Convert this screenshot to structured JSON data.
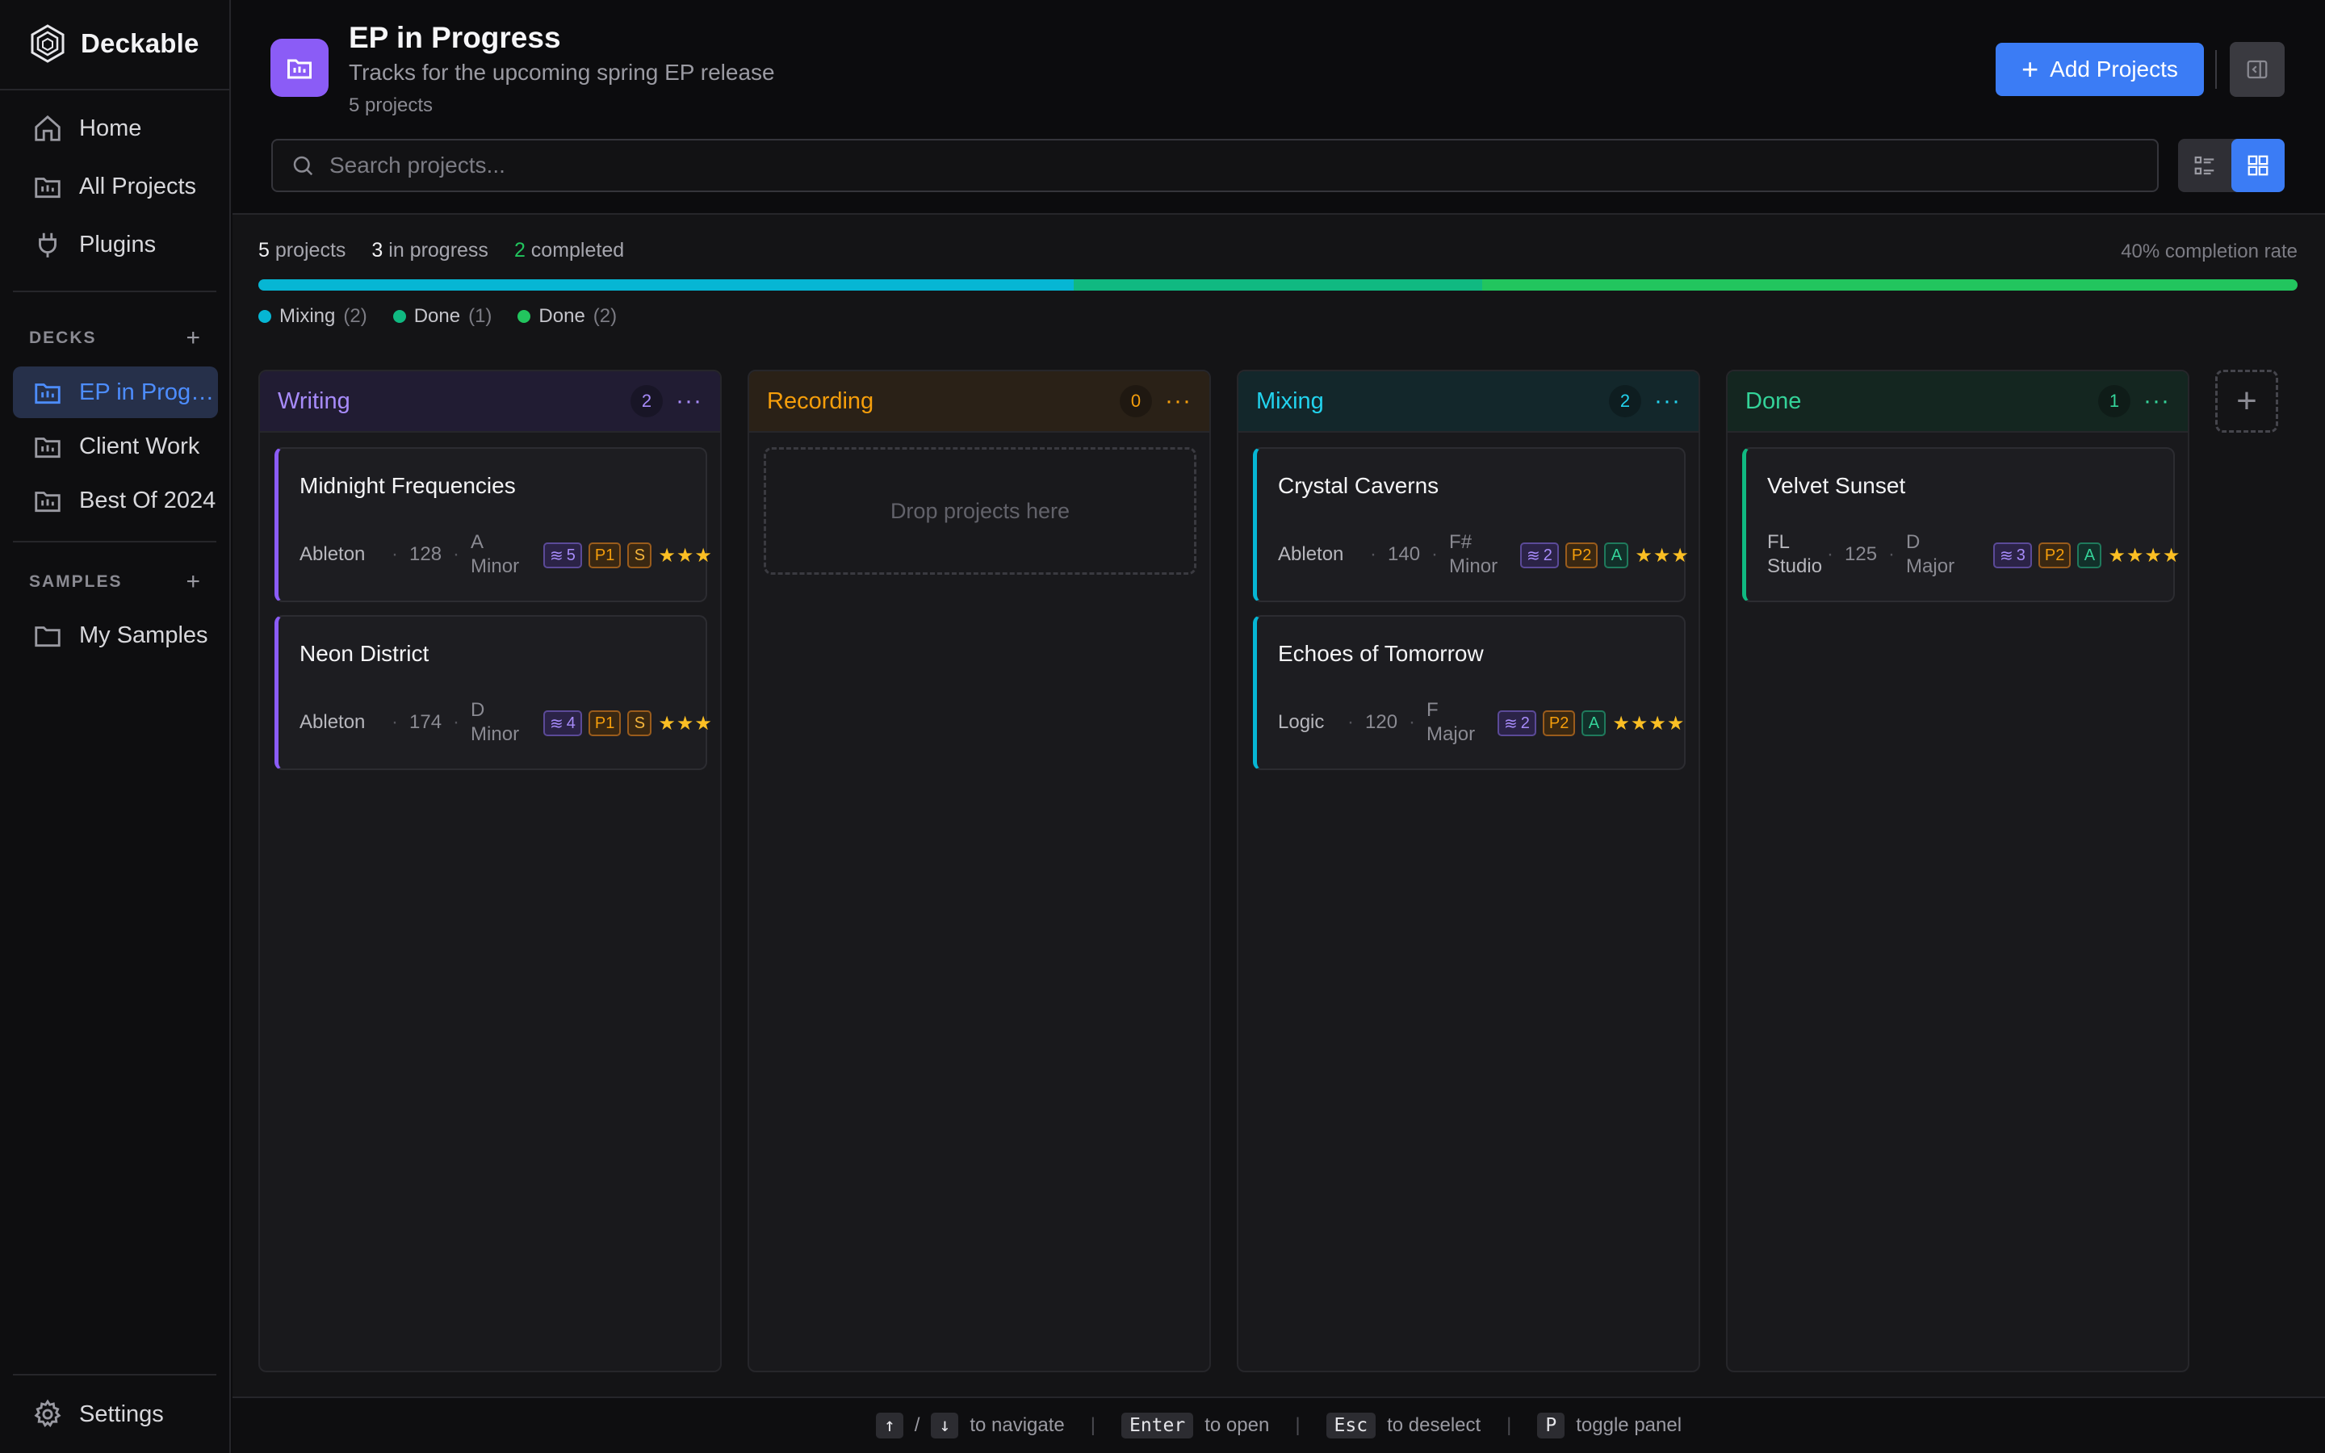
{
  "app": {
    "name": "Deckable"
  },
  "sidebar": {
    "nav": [
      {
        "label": "Home",
        "icon": "home-icon"
      },
      {
        "label": "All Projects",
        "icon": "folder-chart-icon"
      },
      {
        "label": "Plugins",
        "icon": "plug-icon"
      }
    ],
    "decks_heading": "DECKS",
    "decks": [
      {
        "label": "EP in Progress",
        "active": true
      },
      {
        "label": "Client Work",
        "active": false
      },
      {
        "label": "Best Of 2024",
        "active": false
      }
    ],
    "samples_heading": "SAMPLES",
    "samples": [
      {
        "label": "My Samples"
      }
    ],
    "settings_label": "Settings"
  },
  "header": {
    "title": "EP in Progress",
    "subtitle": "Tracks for the upcoming spring EP release",
    "count": "5 projects",
    "add_button": "Add Projects"
  },
  "search": {
    "placeholder": "Search projects..."
  },
  "stats": {
    "projects_num": "5",
    "projects_text": "projects",
    "in_progress_num": "3",
    "in_progress_text": "in progress",
    "completed_num": "2",
    "completed_text": "completed",
    "rate": "40% completion rate",
    "progress_segments": [
      {
        "name": "Mixing",
        "fraction": 0.4,
        "color": "#06b6d4"
      },
      {
        "name": "Done",
        "fraction": 0.2,
        "color": "#10b981"
      },
      {
        "name": "Done",
        "fraction": 0.4,
        "color": "#22c55e"
      }
    ]
  },
  "legend": [
    {
      "label": "Mixing",
      "count": "(2)",
      "color": "#06b6d4"
    },
    {
      "label": "Done",
      "count": "(1)",
      "color": "#10b981"
    },
    {
      "label": "Done",
      "count": "(2)",
      "color": "#22c55e"
    }
  ],
  "columns": [
    {
      "title": "Writing",
      "count": "2",
      "menu": "···",
      "cards": [
        {
          "title": "Midnight Frequencies",
          "daw": "Ableton",
          "bpm": "128",
          "key": "A Minor",
          "layers": "5",
          "priority": "P1",
          "status": "S",
          "stars": "★★★"
        },
        {
          "title": "Neon District",
          "daw": "Ableton",
          "bpm": "174",
          "key": "D Minor",
          "layers": "4",
          "priority": "P1",
          "status": "S",
          "stars": "★★★"
        }
      ]
    },
    {
      "title": "Recording",
      "count": "0",
      "menu": "···",
      "empty": "Drop projects here"
    },
    {
      "title": "Mixing",
      "count": "2",
      "menu": "···",
      "cards": [
        {
          "title": "Crystal Caverns",
          "daw": "Ableton",
          "bpm": "140",
          "key": "F# Minor",
          "layers": "2",
          "priority": "P2",
          "status": "A",
          "stars": "★★★"
        },
        {
          "title": "Echoes of Tomorrow",
          "daw": "Logic",
          "bpm": "120",
          "key": "F Major",
          "layers": "2",
          "priority": "P2",
          "status": "A",
          "stars": "★★★★"
        }
      ]
    },
    {
      "title": "Done",
      "count": "1",
      "menu": "···",
      "cards": [
        {
          "title": "Velvet Sunset",
          "daw": "FL Studio",
          "bpm": "125",
          "key": "D Major",
          "layers": "3",
          "priority": "P2",
          "status": "A",
          "stars": "★★★★"
        }
      ]
    }
  ],
  "footer": {
    "up": "↑",
    "slash": "/",
    "down": "↓",
    "navigate": "to navigate",
    "enter": "Enter",
    "open": "to open",
    "esc": "Esc",
    "deselect": "to deselect",
    "p": "P",
    "toggle": "toggle panel"
  }
}
